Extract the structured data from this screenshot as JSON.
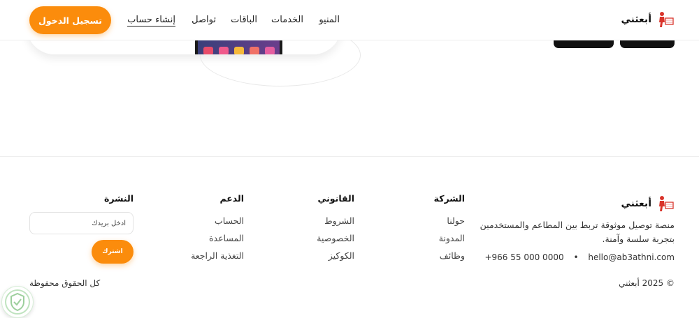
{
  "header": {
    "brand": "أبعثني",
    "nav": {
      "menu": "المنيو",
      "services": "الخدمات",
      "packages": "الباقات",
      "contact": "تواصل",
      "register": "إنشاء حساب"
    },
    "login_label": "تسجيل الدخول"
  },
  "footer": {
    "brand": "أبعثني",
    "tagline": "منصة توصيل موثوقة تربط بين المطاعم والمستخدمين بتجربة سلسة وآمنة.",
    "email": "hello@ab3athni.com",
    "phone": "+966 55 000 0000",
    "copyright": "© 2025 أبعثني",
    "rights": "كل الحقوق محفوظة",
    "company": {
      "title": "الشركة",
      "links": [
        "حولنا",
        "المدونة",
        "وظائف"
      ]
    },
    "legal": {
      "title": "القانوني",
      "links": [
        "الشروط",
        "الخصوصية",
        "الكوكيز"
      ]
    },
    "support": {
      "title": "الدعم",
      "links": [
        "الحساب",
        "المساعدة",
        "التغذية الراجعة"
      ]
    },
    "newsletter": {
      "title": "النشرة",
      "placeholder": "ادخل بريدك",
      "subscribe_label": "اشترك"
    }
  },
  "colors": {
    "accent": "#fb8c0c",
    "logo_red": "#d9342b"
  }
}
